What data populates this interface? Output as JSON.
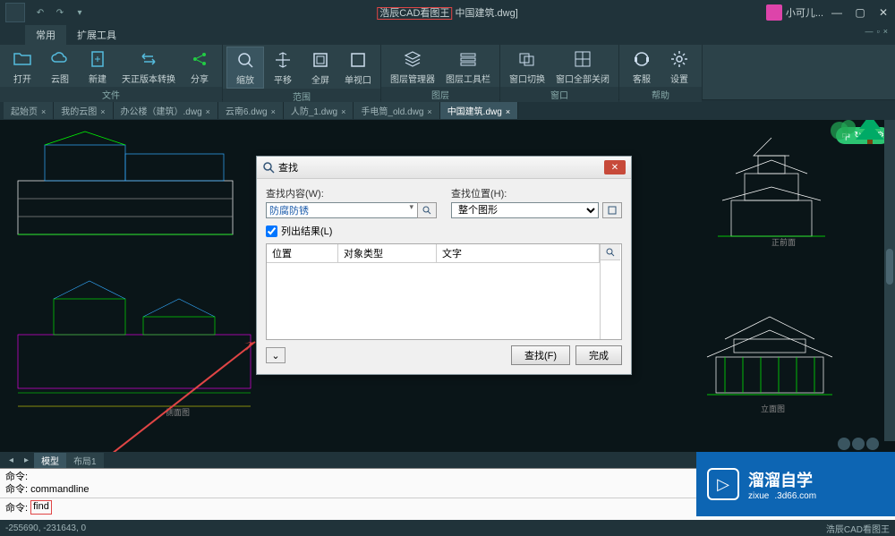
{
  "app": {
    "title_prefix": "浩辰CAD看图王",
    "title_suffix": "中国建筑.dwg]",
    "user": "小可儿..."
  },
  "menu_tabs": [
    "常用",
    "扩展工具"
  ],
  "ribbon": {
    "groups": [
      {
        "label": "文件",
        "buttons": [
          {
            "label": "打开",
            "icon": "folder"
          },
          {
            "label": "云图",
            "icon": "cloud"
          },
          {
            "label": "新建",
            "icon": "new"
          },
          {
            "label": "天正版本转换",
            "icon": "convert"
          },
          {
            "label": "分享",
            "icon": "share"
          }
        ]
      },
      {
        "label": "范围",
        "buttons": [
          {
            "label": "缩放",
            "icon": "zoom",
            "active": true
          },
          {
            "label": "平移",
            "icon": "pan"
          },
          {
            "label": "全屏",
            "icon": "fullscreen"
          },
          {
            "label": "单视口",
            "icon": "viewport"
          }
        ]
      },
      {
        "label": "图层",
        "buttons": [
          {
            "label": "图层管理器",
            "icon": "layers"
          },
          {
            "label": "图层工具栏",
            "icon": "layertool"
          }
        ]
      },
      {
        "label": "窗口",
        "buttons": [
          {
            "label": "窗口切换",
            "icon": "winswitch"
          },
          {
            "label": "窗口全部关闭",
            "icon": "closeall"
          }
        ]
      },
      {
        "label": "帮助",
        "buttons": [
          {
            "label": "客服",
            "icon": "support"
          },
          {
            "label": "设置",
            "icon": "settings"
          }
        ]
      }
    ]
  },
  "doc_tabs": [
    {
      "label": "起始页"
    },
    {
      "label": "我的云图"
    },
    {
      "label": "办公楼（建筑）.dwg"
    },
    {
      "label": "云南6.dwg"
    },
    {
      "label": "人防_1.dwg"
    },
    {
      "label": "手电筒_old.dwg"
    },
    {
      "label": "中国建筑.dwg",
      "active": true
    }
  ],
  "side_badge": {
    "text": "中",
    "icons": [
      "↻",
      "✦",
      "⚙"
    ]
  },
  "find_dialog": {
    "title": "查找",
    "content_label": "查找内容(W):",
    "content_value": "防腐防锈",
    "location_label": "查找位置(H):",
    "location_value": "整个图形",
    "list_results": "列出结果(L)",
    "cols": {
      "position": "位置",
      "type": "对象类型",
      "text": "文字"
    },
    "btn_find": "查找(F)",
    "btn_done": "完成"
  },
  "layout_tabs": {
    "model": "模型",
    "layout1": "布局1"
  },
  "cmd": {
    "line1": "命令:",
    "line2_prefix": "命令:",
    "line2_cmd": "commandline",
    "input_prefix": "命令:",
    "input_value": "find"
  },
  "status": {
    "coords": "-255690, -231643, 0",
    "right": "浩辰CAD看图王"
  },
  "watermark": {
    "big": "溜溜自学",
    "site": "zixue",
    "domain": ".3d66.com"
  },
  "drawing_labels": {
    "front": "正前面",
    "side": "立面图"
  }
}
